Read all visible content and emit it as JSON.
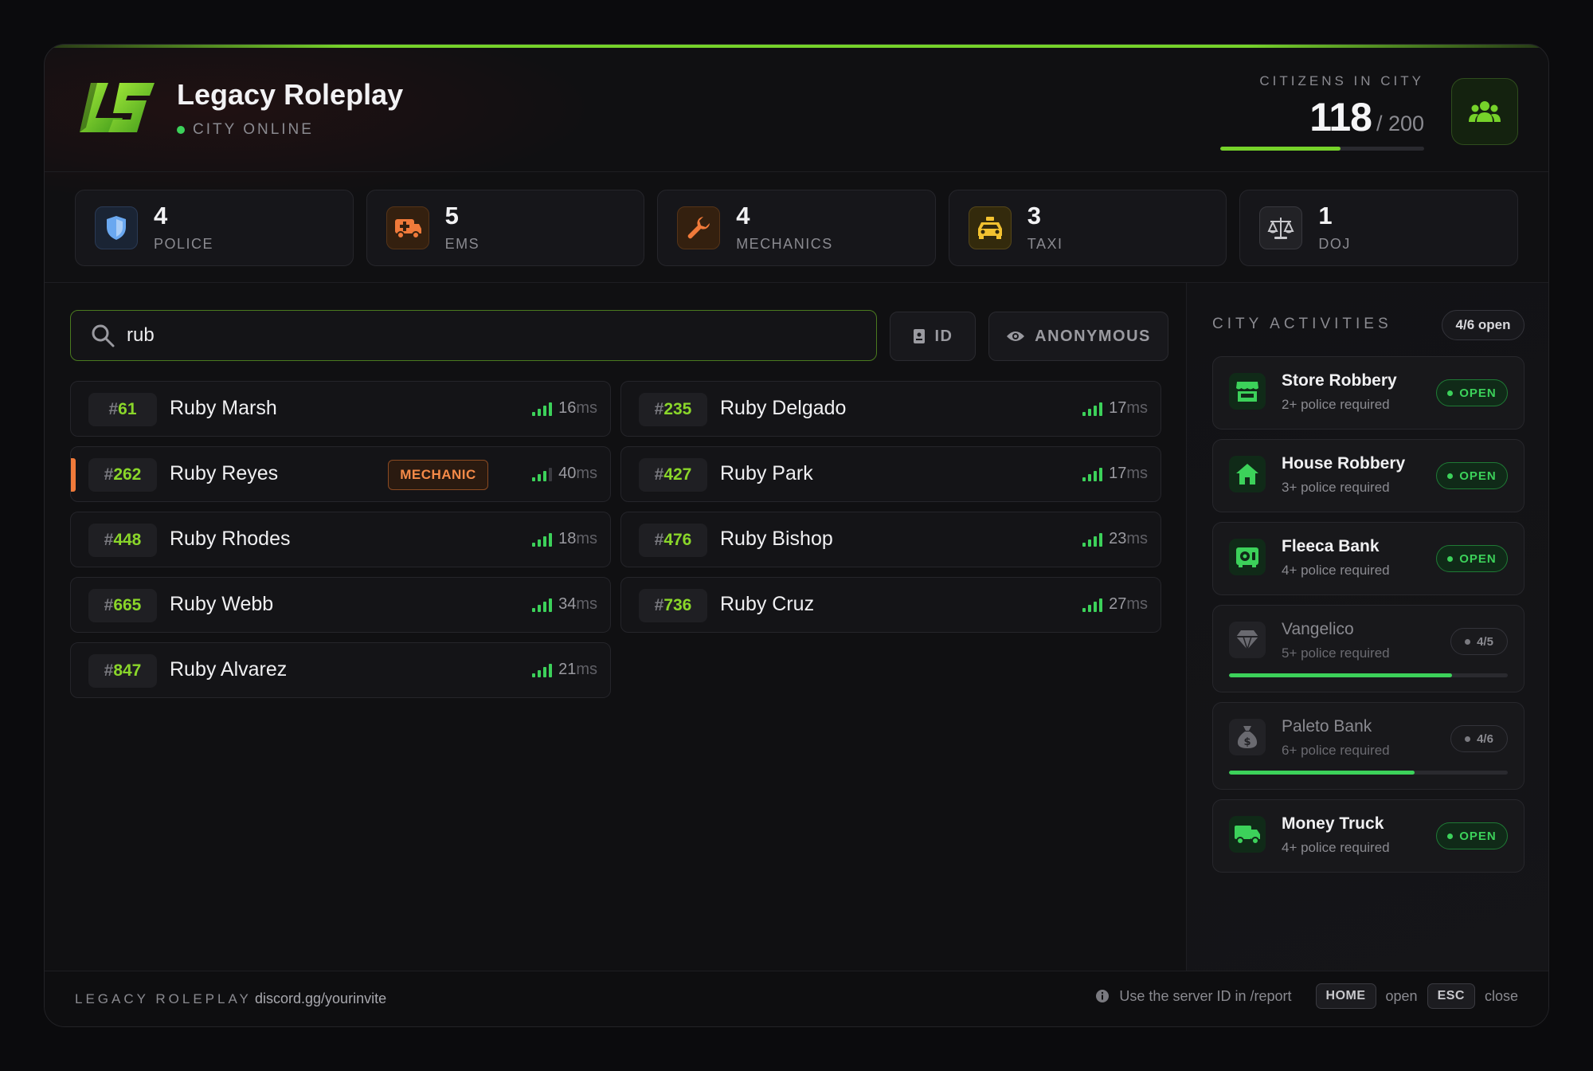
{
  "header": {
    "title": "Legacy Roleplay",
    "status": "CITY ONLINE",
    "citizens_label": "CITIZENS IN CITY",
    "citizens_count": "118",
    "citizens_max": "/ 200",
    "citizens_fraction": 0.59
  },
  "jobs": [
    {
      "count": "4",
      "label": "POLICE",
      "icon": "shield-icon",
      "color": "#6aa8f0"
    },
    {
      "count": "5",
      "label": "EMS",
      "icon": "ambulance-icon",
      "color": "#f07a3a"
    },
    {
      "count": "4",
      "label": "MECHANICS",
      "icon": "wrench-icon",
      "color": "#f07a3a"
    },
    {
      "count": "3",
      "label": "TAXI",
      "icon": "taxi-icon",
      "color": "#f2c230"
    },
    {
      "count": "1",
      "label": "DOJ",
      "icon": "scales-icon",
      "color": "#c8c8cc"
    }
  ],
  "search": {
    "value": "rub",
    "id_label": "ID",
    "anon_label": "ANONYMOUS"
  },
  "players": [
    {
      "hash": "#",
      "id": "61",
      "name": "Ruby Marsh",
      "ping": "16",
      "ms": "ms"
    },
    {
      "hash": "#",
      "id": "235",
      "name": "Ruby Delgado",
      "ping": "17",
      "ms": "ms"
    },
    {
      "hash": "#",
      "id": "262",
      "name": "Ruby Reyes",
      "ping": "40",
      "ms": "ms",
      "badge": "MECHANIC"
    },
    {
      "hash": "#",
      "id": "427",
      "name": "Ruby Park",
      "ping": "17",
      "ms": "ms"
    },
    {
      "hash": "#",
      "id": "448",
      "name": "Ruby Rhodes",
      "ping": "18",
      "ms": "ms"
    },
    {
      "hash": "#",
      "id": "476",
      "name": "Ruby Bishop",
      "ping": "23",
      "ms": "ms"
    },
    {
      "hash": "#",
      "id": "665",
      "name": "Ruby Webb",
      "ping": "34",
      "ms": "ms"
    },
    {
      "hash": "#",
      "id": "736",
      "name": "Ruby Cruz",
      "ping": "27",
      "ms": "ms"
    },
    {
      "hash": "#",
      "id": "847",
      "name": "Ruby Alvarez",
      "ping": "21",
      "ms": "ms"
    }
  ],
  "activities": {
    "title": "CITY ACTIVITIES",
    "count": "4/6 open",
    "items": [
      {
        "name": "Store Robbery",
        "req": "2+ police required",
        "status": "OPEN",
        "icon": "store-icon"
      },
      {
        "name": "House Robbery",
        "req": "3+ police required",
        "status": "OPEN",
        "icon": "house-icon"
      },
      {
        "name": "Fleeca Bank",
        "req": "4+ police required",
        "status": "OPEN",
        "icon": "vault-icon"
      },
      {
        "name": "Vangelico",
        "req": "5+ police required",
        "status": "4/5",
        "progress": 0.8,
        "icon": "diamond-icon"
      },
      {
        "name": "Paleto Bank",
        "req": "6+ police required",
        "status": "4/6",
        "progress": 0.667,
        "icon": "money-bag-icon"
      },
      {
        "name": "Money Truck",
        "req": "4+ police required",
        "status": "OPEN",
        "icon": "truck-icon"
      }
    ]
  },
  "footer": {
    "brand": "LEGACY ROLEPLAY",
    "link": "discord.gg/yourinvite",
    "hint": "Use the server ID in /report",
    "key_open": "HOME",
    "open_label": "open",
    "key_close": "ESC",
    "close_label": "close"
  }
}
